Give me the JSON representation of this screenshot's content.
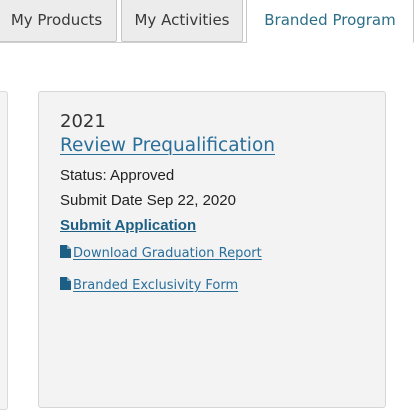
{
  "tabs": [
    {
      "label": "My Products"
    },
    {
      "label": "My Activities"
    },
    {
      "label": "Branded Program"
    }
  ],
  "card": {
    "year": "2021",
    "title": "Review Prequalification",
    "status": "Status: Approved",
    "submit_date": "Submit Date Sep 22, 2020",
    "submit_link": "Submit Application",
    "documents": [
      {
        "label": "Download Graduation Report",
        "icon": "file-icon"
      },
      {
        "label": "Branded Exclusivity Form",
        "icon": "file-icon"
      }
    ]
  },
  "colors": {
    "link": "#2a6e9a",
    "active_tab_text": "#2b6f87",
    "card_bg": "#f3f3f3"
  }
}
